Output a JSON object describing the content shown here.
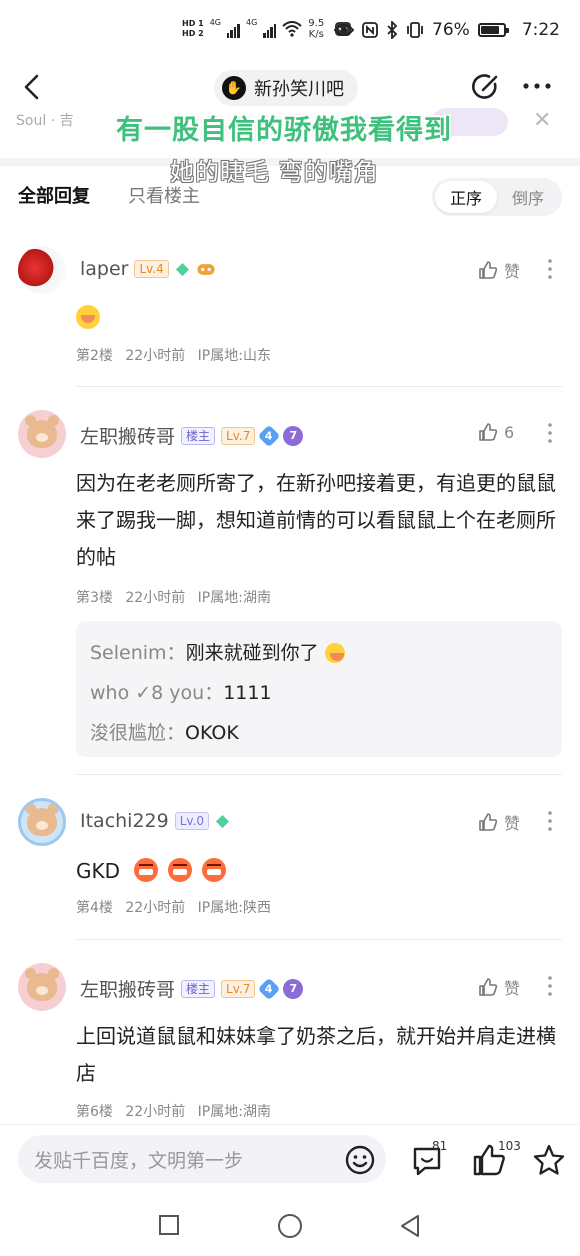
{
  "status_bar": {
    "hd1": "HD 1",
    "hd2": "HD 2",
    "net1": "4G",
    "net2": "4G",
    "speed_value": "9.5",
    "speed_unit": "K/s",
    "battery": "76%",
    "time": "7:22"
  },
  "nav": {
    "forum_name": "新孙笑川吧"
  },
  "overlay": {
    "caption_line1": "有一股自信的骄傲我看得到",
    "caption_line2": "她的睫毛 弯的嘴角",
    "faint_text": "Soul · 吉"
  },
  "tabs": {
    "all_replies": "全部回复",
    "only_op": "只看楼主",
    "sort_asc": "正序",
    "sort_desc": "倒序"
  },
  "posts": [
    {
      "username": "laper",
      "level": "Lv.4",
      "is_host": false,
      "like_label": "赞",
      "floor": "第2楼",
      "time": "22小时前",
      "ip": "IP属地:山东"
    },
    {
      "username": "左职搬砖哥",
      "host_label": "楼主",
      "level": "Lv.7",
      "gem_num": "4",
      "badge_num": "7",
      "like_label": "6",
      "content": "因为在老老厕所寄了，在新孙吧接着更，有追更的鼠鼠来了踢我一脚，想知道前情的可以看鼠鼠上个在老厕所的帖",
      "floor": "第3楼",
      "time": "22小时前",
      "ip": "IP属地:湖南",
      "sub_replies": [
        {
          "user": "Selenim：",
          "text": "刚来就碰到你了"
        },
        {
          "user": "who ✓8 you：",
          "text": "1111"
        },
        {
          "user": "浚很尴尬：",
          "text": "OKOK"
        }
      ]
    },
    {
      "username": "Itachi229",
      "level": "Lv.0",
      "like_label": "赞",
      "content": "GKD",
      "floor": "第4楼",
      "time": "22小时前",
      "ip": "IP属地:陕西"
    },
    {
      "username": "左职搬砖哥",
      "host_label": "楼主",
      "level": "Lv.7",
      "gem_num": "4",
      "badge_num": "7",
      "like_label": "赞",
      "content": "上回说道鼠鼠和妹妹拿了奶茶之后，就开始并肩走进横店",
      "floor": "第6楼",
      "time": "22小时前",
      "ip": "IP属地:湖南"
    }
  ],
  "bottom": {
    "reply_placeholder": "发贴千百度，文明第一步",
    "comment_count": "81",
    "like_count": "103"
  },
  "colors": {
    "accent_green": "#3fc07d",
    "level_orange": "#e28a2a",
    "level_purple": "#7c74d9"
  }
}
